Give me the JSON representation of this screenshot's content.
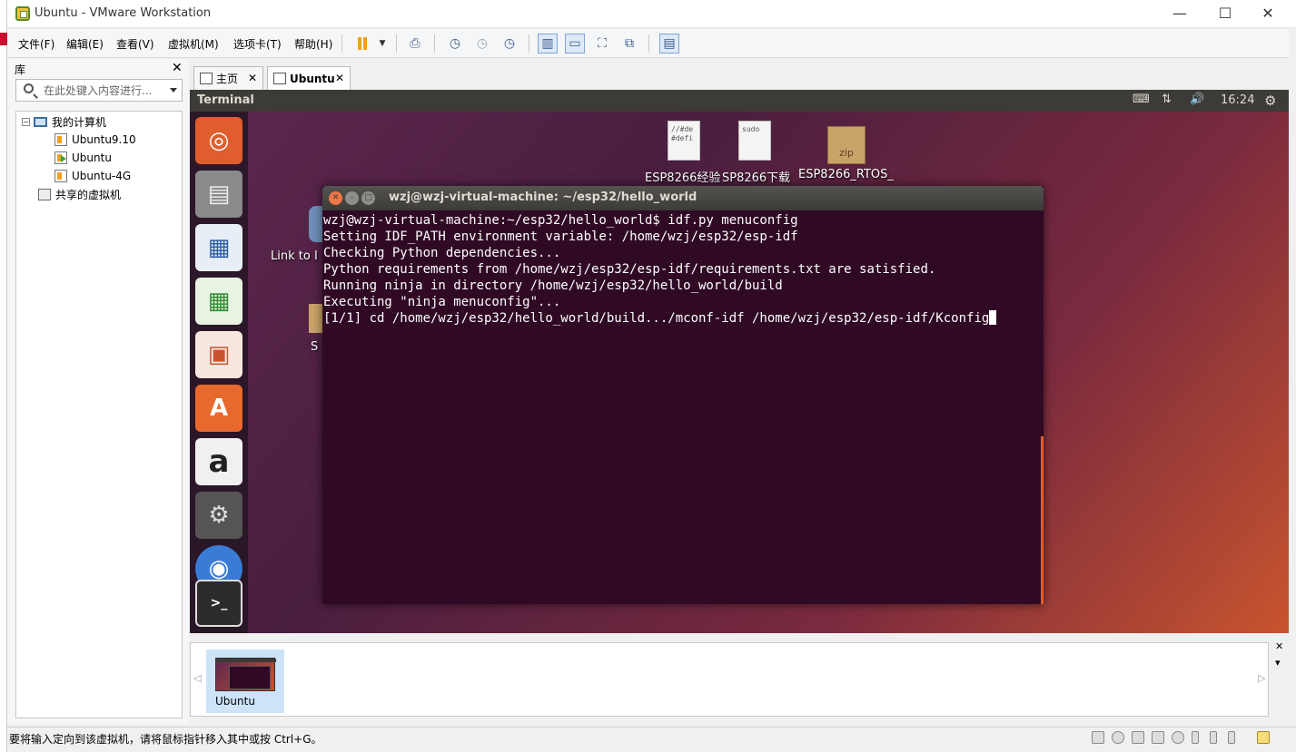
{
  "window": {
    "title": "Ubuntu - VMware Workstation",
    "controls": {
      "minimize": "—",
      "maximize": "☐",
      "close": "✕"
    }
  },
  "menu": {
    "items": [
      "文件(F)",
      "编辑(E)",
      "查看(V)",
      "虚拟机(M)",
      "选项卡(T)",
      "帮助(H)"
    ]
  },
  "library": {
    "title": "库",
    "close": "✕",
    "search_placeholder": "在此处键入内容进行...",
    "tree": {
      "root": "我的计算机",
      "expander": "−",
      "vms": [
        "Ubuntu9.10",
        "Ubuntu",
        "Ubuntu-4G"
      ],
      "shared": "共享的虚拟机"
    }
  },
  "tabs": [
    {
      "label": "主页",
      "close": "✕"
    },
    {
      "label": "Ubuntu",
      "close": "✕"
    }
  ],
  "vm": {
    "topbar_title": "Terminal",
    "indicators": [
      "⌨",
      "⇅",
      "🔊"
    ],
    "clock": "16:24",
    "gear": "⚙",
    "desktop": {
      "file1_text": "//#de\n#defi",
      "file2_text": "sudo",
      "zip_text": "zip",
      "label_a": "ESP8266经验",
      "label_b": "SP8266下载",
      "label_c": "ESP8266_RTOS_",
      "label_link": "Link to I",
      "label_s": "S"
    },
    "launcher_glyphs": [
      "◎",
      "▤",
      "▦",
      "▦",
      "▣",
      "A",
      "a",
      "⚙",
      "◉",
      ">_"
    ],
    "terminal": {
      "title": "wzj@wzj-virtual-machine: ~/esp32/hello_world",
      "buttons": {
        "close": "✕",
        "min": "–",
        "max": "□"
      },
      "lines": [
        "wzj@wzj-virtual-machine:~/esp32/hello_world$ idf.py menuconfig",
        "Setting IDF_PATH environment variable: /home/wzj/esp32/esp-idf",
        "Checking Python dependencies...",
        "Python requirements from /home/wzj/esp32/esp-idf/requirements.txt are satisfied.",
        "Running ninja in directory /home/wzj/esp32/hello_world/build",
        "Executing \"ninja menuconfig\"...",
        "[1/1] cd /home/wzj/esp32/hello_world/build.../mconf-idf /home/wzj/esp32/esp-idf/Kconfig"
      ]
    }
  },
  "thumbnails": {
    "items": [
      {
        "label": "Ubuntu"
      }
    ],
    "left_arrow": "◁",
    "right_arrow": "▷",
    "close": "✕",
    "dropdown": "▾"
  },
  "status": {
    "text": "要将输入定向到该虚拟机，请将鼠标指针移入其中或按 Ctrl+G。"
  }
}
